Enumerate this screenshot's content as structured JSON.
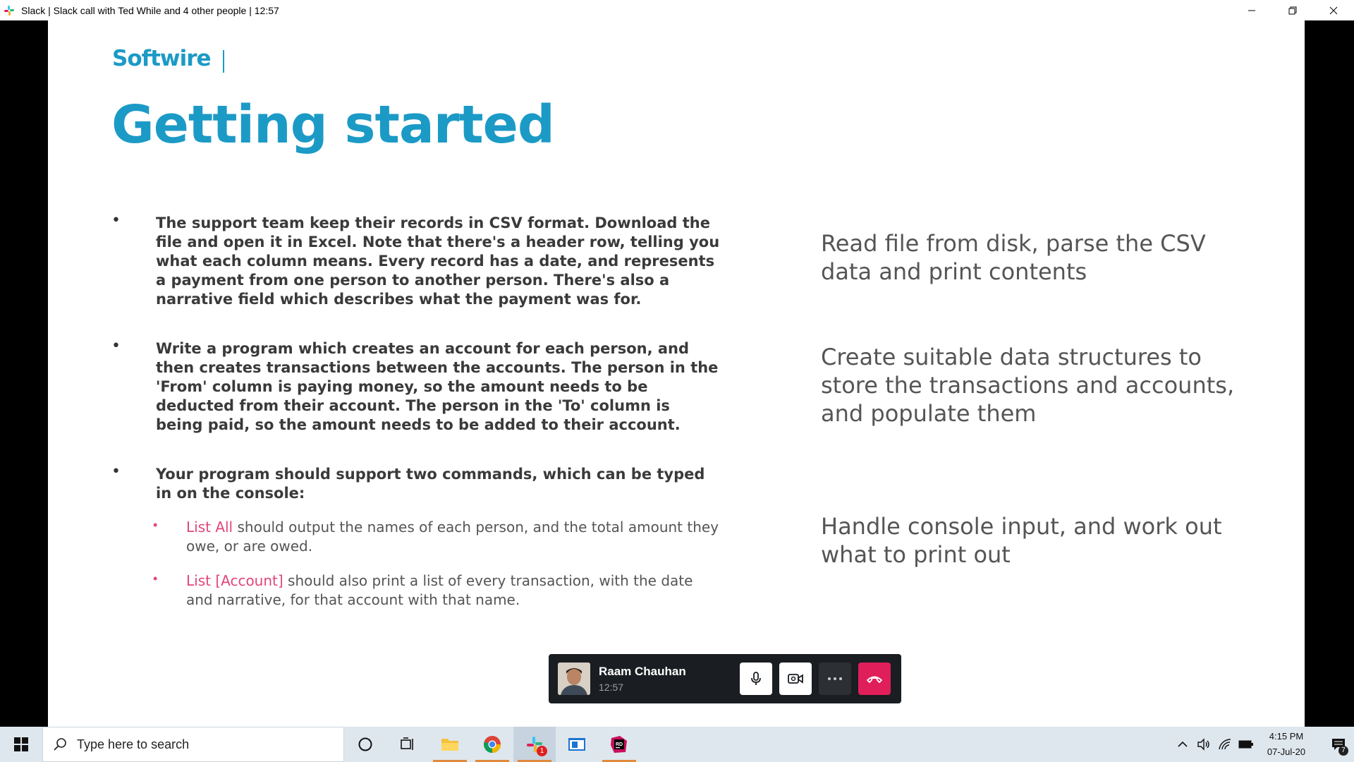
{
  "window": {
    "title": "Slack | Slack call with Ted While and 4 other people | 12:57",
    "minimize": "minimize",
    "maximize": "restore",
    "close": "close"
  },
  "slide": {
    "logo": "Softwire",
    "heading": "Getting started",
    "bullets": [
      {
        "marker": "•",
        "text": "The support team keep their records in CSV format. Download the file and open it in Excel. Note that there's a header row, telling you what each column means. Every record has a date, and represents a payment from one person to another person. There's also a narrative field which describes what the payment was for."
      },
      {
        "marker": "•",
        "text": "Write a program which creates an account for each person, and then creates transactions between the accounts. The person in the 'From' column is paying money, so the amount needs to be deducted from their account. The person in the 'To' column is being paid, so the amount needs to be added to their account."
      },
      {
        "marker": "•",
        "text": "Your program should support two commands, which can be typed in on the console:"
      }
    ],
    "sub_bullets": [
      {
        "marker": "•",
        "keyword": "List All",
        "text": " should output the names of each person, and the total amount they owe, or are owed."
      },
      {
        "marker": "•",
        "keyword": "List [Account]",
        "text": " should also print a list of every transaction, with the date and narrative, for that account with that name."
      }
    ],
    "side_notes": [
      "Read file from disk, parse the CSV data and print contents",
      "Create suitable data structures to store the transactions and accounts, and populate them",
      "Handle console input, and work out what to print out"
    ]
  },
  "call": {
    "name": "Raam Chauhan",
    "time": "12:57",
    "icons": [
      "microphone-icon",
      "video-camera-icon",
      "more-icon",
      "hang-up-icon"
    ],
    "colors": {
      "background": "#1a1d21",
      "hangup": "#e01e5a"
    }
  },
  "taskbar": {
    "search_placeholder": "Type here to search",
    "time": "4:15 PM",
    "date": "07-Jul-20",
    "slack_badge": "1",
    "notification_count": "7"
  },
  "colors": {
    "accent": "#1c9ac6",
    "keyword": "#e2457b"
  }
}
